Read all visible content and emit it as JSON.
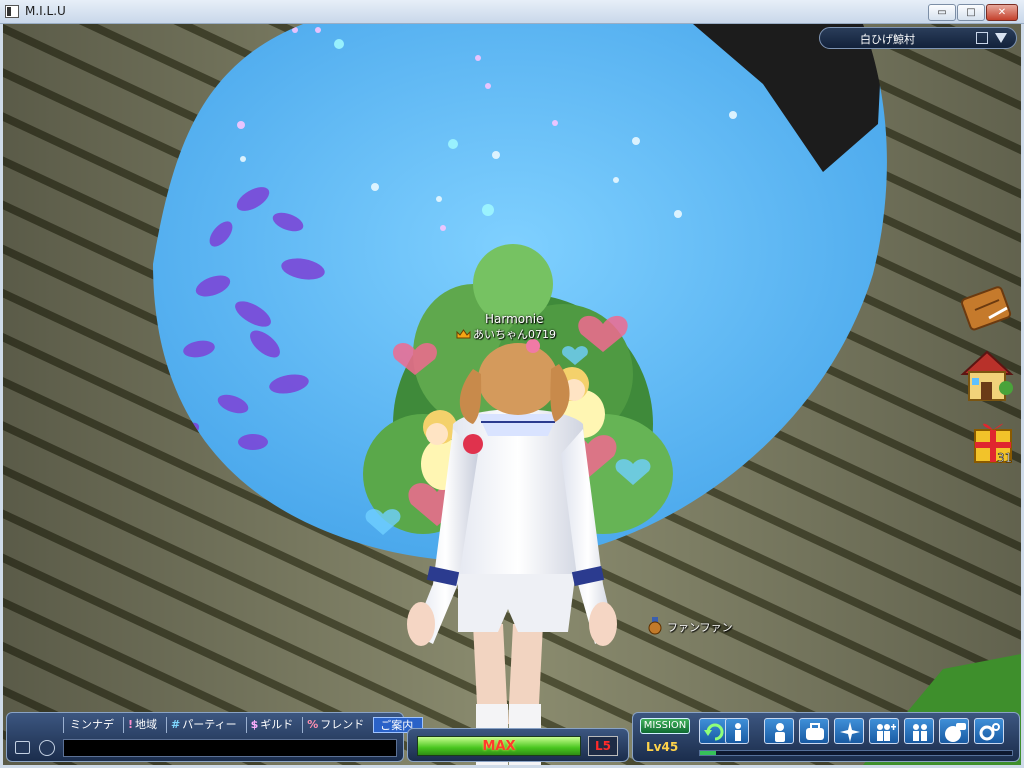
{
  "window": {
    "title": "M.I.L.U",
    "minimize": "▭",
    "maximize": "□",
    "close": "✕"
  },
  "zone": {
    "name": "白ひげ鯨村"
  },
  "player": {
    "title": "Harmonie",
    "name": "あいちゃん0719"
  },
  "npc": {
    "name": "ファンファン"
  },
  "side_icons": {
    "gift_count": "31"
  },
  "chat": {
    "tabs": [
      {
        "symbol": "",
        "label": "ミンナデ"
      },
      {
        "symbol": "!",
        "label": "地域"
      },
      {
        "symbol": "#",
        "label": "パーティー"
      },
      {
        "symbol": "$",
        "label": "ギルド"
      },
      {
        "symbol": "%",
        "label": "フレンド"
      },
      {
        "symbol": "",
        "label": "ご案内"
      }
    ],
    "input_value": ""
  },
  "gauge": {
    "label": "MAX",
    "level_badge": "L5",
    "fill_fraction": 1.0
  },
  "menu": {
    "mission_label": "MISSION",
    "level_prefix": "Lv",
    "level_value": "45",
    "exp_fraction": 0.05,
    "buttons": [
      "return",
      "character",
      "status",
      "inventory",
      "skills",
      "party",
      "friends",
      "chat",
      "settings"
    ]
  },
  "colors": {
    "sky": "#2f9ce6",
    "panel": "#1b2d4c",
    "gauge_fill": "#49c61f",
    "gauge_text": "#ff3b2e",
    "level_text": "#ffd34a"
  }
}
